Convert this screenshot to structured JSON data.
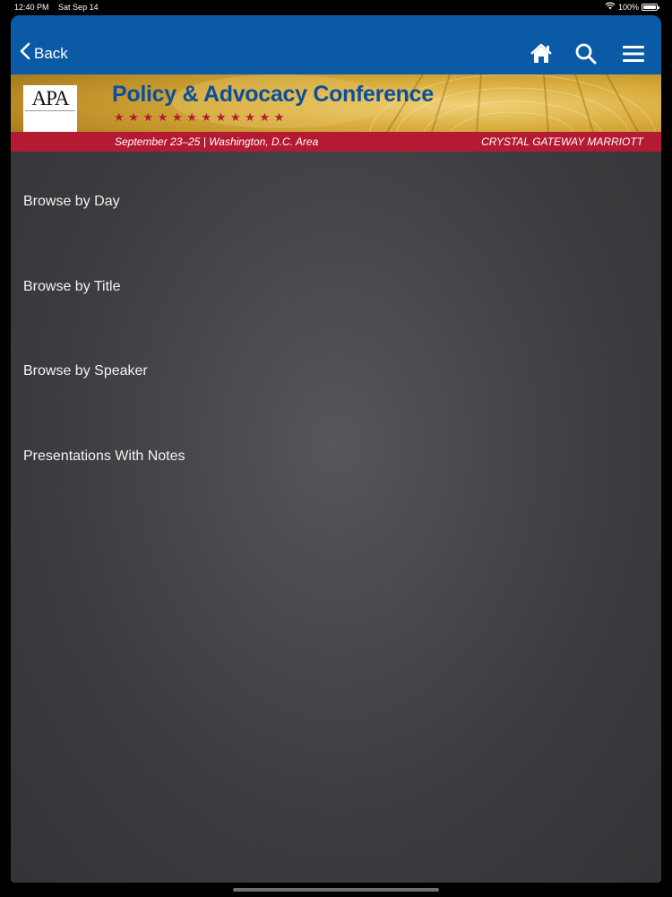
{
  "status_bar": {
    "time": "12:40 PM",
    "date": "Sat Sep 14",
    "battery": "100%",
    "battery_level": 1.0,
    "icons": [
      "wifi-icon",
      "battery-icon"
    ]
  },
  "nav": {
    "back_label": "Back",
    "icons": [
      "home-icon",
      "search-icon",
      "hamburger-menu-icon"
    ],
    "bar_color": "#0a5aa5"
  },
  "banner": {
    "logo": "APA",
    "title": "Policy & Advocacy Conference",
    "date_location": "September 23–25 | Washington, D.C. Area",
    "venue": "CRYSTAL GATEWAY MARRIOTT",
    "title_color": "#0b4f9c",
    "strip_color": "#b51a33"
  },
  "menu": {
    "items": [
      {
        "label": "Browse by Day"
      },
      {
        "label": "Browse by Title"
      },
      {
        "label": "Browse by Speaker"
      },
      {
        "label": "Presentations With Notes"
      }
    ]
  }
}
